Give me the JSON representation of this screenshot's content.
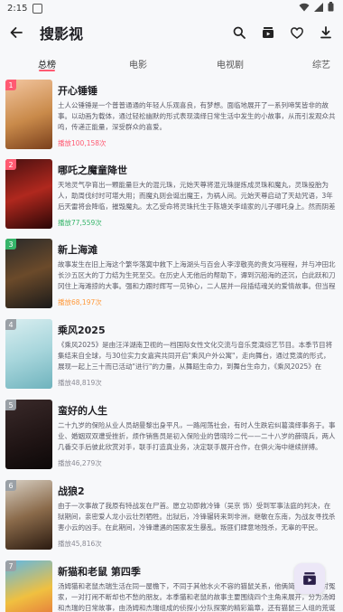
{
  "status": {
    "time": "2:15"
  },
  "app": {
    "title": "搜影视"
  },
  "tabs": [
    "总榜",
    "电影",
    "电视剧",
    "综艺"
  ],
  "items": [
    {
      "rank": "1",
      "title": "开心锤锤",
      "desc": "土人公锤锤是一个普普通通的年轻人乐观喜良，有梦想。面临地展开了一系列啼笑皆非的故事。以动画为载体，通过轻松幽默的形式表现演绎日常生活中发生的小故事，从而引发观众共鸣，传递正能量，深受群众的喜爱。",
      "plays": "播放100,158次",
      "color": "#ff5a72"
    },
    {
      "rank": "2",
      "title": "哪吒之魔童降世",
      "desc": "天地灵气孕育出一颗能量巨大的混元珠，元始天尊将混元珠提炼成灵珠和魔丸，灵珠投胎为人，助周伐纣时可堪大用；而魔丸则会诞出魔王，为祸人间。元始天尊启动了天劫咒语，3年后天雷将会降临，摧毁魔丸。太乙受命将灵珠托生于陈塘关李靖家的儿子哪吒身上。然而阴差阳错，灵珠和魔丸竟然被掉包。",
      "plays": "播放77,559次",
      "color": "#36b56a"
    },
    {
      "rank": "3",
      "title": "新上海滩",
      "desc": "故事发生在旧上海这个繁华落寞中救下上海湖头与百会人李淳敬亮的贵女冯程程，并与冲田北长沙五区大的丁力结为生死至交。在历史人无他后的帮助下，谭到沉船海的还沉，白此跃和刀冈住上海滩掠的大事。强和力跟时辉写一见钟心，二人居并一段插结魂关的爱情故事。但当程龙经接通后。",
      "plays": "播放68,197次",
      "color": "#ff9a3c"
    },
    {
      "rank": "4",
      "title": "乘风2025",
      "desc": "《乘风2025》是由汪洋湖南卫视的一档国际女性文化交流与音乐竞演综艺节目。本季节目将集结来自全球，与30位实力女嘉宾共同开启\"乘风户外公寓\"，走向舞台，通过竞演的形式，展现一起上三十而已活动\"进行\"的力量，从舞蹈生命力，到舞台生命力，《乘风2025》在以\"她\"为主体的叙事里。",
      "plays": "播放48,819次",
      "color": "#9aa0a6"
    },
    {
      "rank": "5",
      "title": "蛮好的人生",
      "desc": "二十九岁的保险从业人员胡曼黎出身平凡，一路闯荡社会，有时人生跌宕纠葛演绎事务于。事业、婚姻双双遭受挫折，烦作销售员是初入保险业的曾晓玲二代——二十八岁的薛晓兵，两人几番交手后彼此欣赏对手，联手打造真业务，决定联手展开合作，在俱火海中继续拼搏。",
      "plays": "播放46,279次",
      "color": "#9aa0a6"
    },
    {
      "rank": "6",
      "title": "战狼2",
      "desc": "由于一次事故了我原有特战发在尸首。愿立功即救冷锋（吴京 饰）受到军事法庭的判决，在狱期间，亲密爱人龙小云壮烈牺牲。出狱后，冷锋辗转来到非洲，继敏在东南，为战友寻找杀害小云的凶手。在此期间，冷锋遭遇的国家发生暴乱。叛匪们肆意地残杀，无辜的平民。",
      "plays": "播放45,816次",
      "color": "#9aa0a6"
    },
    {
      "rank": "7",
      "title": "新猫和老鼠 第四季",
      "desc": "汤姆猫和老鼠杰瑞生活在同一屋檐下，不同于其他水火不容的猫鼠关系，他俩简直就是一对冤家，一对打闹不断却也不愁的朋友。本季猫和老鼠的故事主要围绕四个主角来展开，分为汤姆和杰瑞的日常故事，由汤姆和杰瑞组成的侦探小分队探案的精彩篇章，还有猫鼠三人组的荒诞冒险。",
      "plays": "",
      "color": "#9aa0a6"
    }
  ],
  "colors": {
    "accent": "#ff5a72",
    "plays_red": "#ff5a72",
    "plays_green": "#36b56a",
    "plays_orange": "#ff9a3c",
    "plays_gray": "#8a8a94"
  }
}
